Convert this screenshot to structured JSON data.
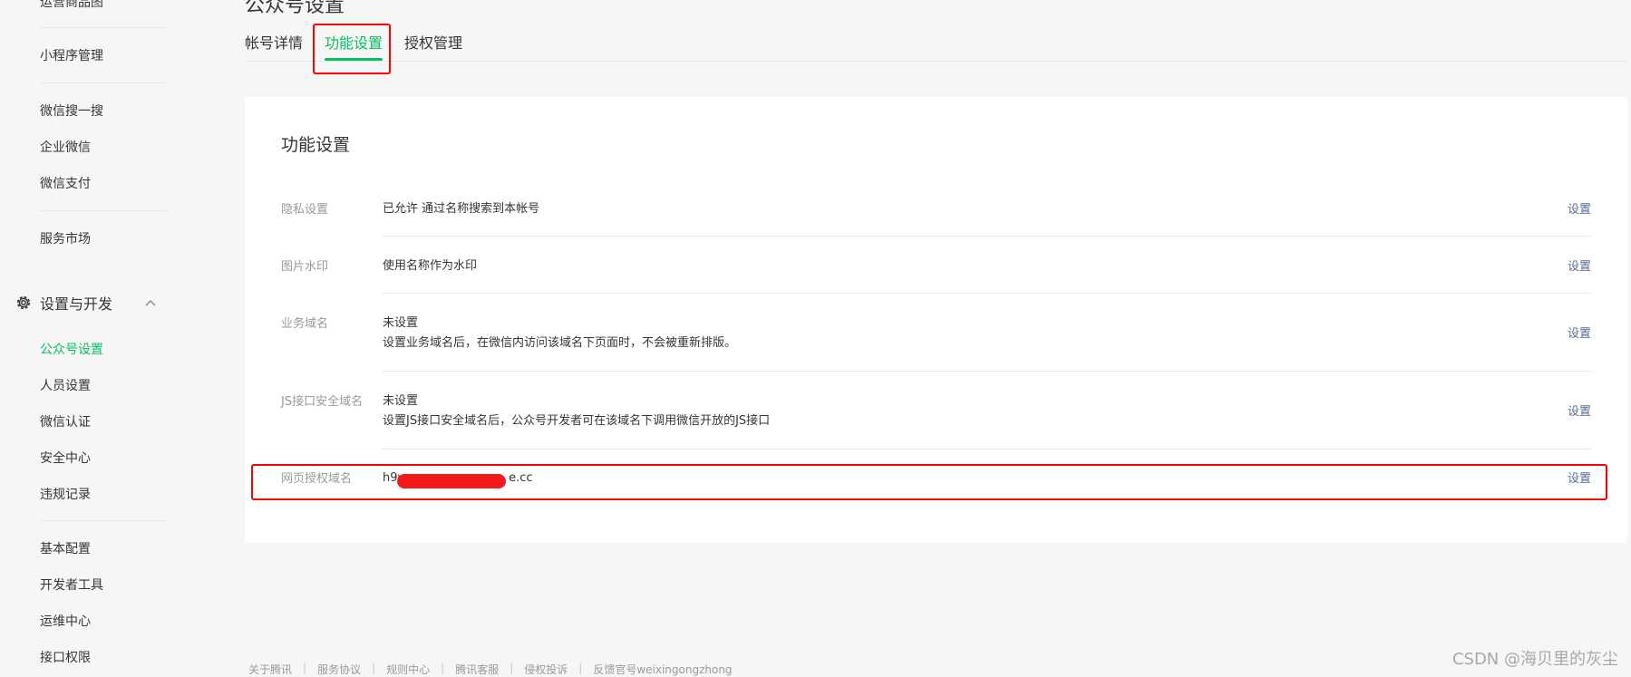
{
  "sidebar": {
    "top_cut": "运营商品图",
    "items": [
      "小程序管理",
      "微信搜一搜",
      "企业微信",
      "微信支付",
      "服务市场"
    ],
    "group": {
      "label": "设置与开发",
      "icon": "gear-icon",
      "chevron": "chevron-up-icon"
    },
    "group_items": [
      "公众号设置",
      "人员设置",
      "微信认证",
      "安全中心",
      "违规记录"
    ],
    "bottom_items": [
      "基本配置",
      "开发者工具",
      "运维中心",
      "接口权限"
    ],
    "active_item": "公众号设置"
  },
  "page": {
    "title": "公众号设置"
  },
  "tabs": [
    "帐号详情",
    "功能设置",
    "授权管理"
  ],
  "active_tab": "功能设置",
  "card": {
    "title": "功能设置",
    "rows": [
      {
        "label": "隐私设置",
        "value": "已允许 通过名称搜索到本帐号",
        "desc": "",
        "action": "设置"
      },
      {
        "label": "图片水印",
        "value": "使用名称作为水印",
        "desc": "",
        "action": "设置"
      },
      {
        "label": "业务域名",
        "value": "未设置",
        "desc": "设置业务域名后，在微信内访问该域名下页面时，不会被重新排版。",
        "action": "设置"
      },
      {
        "label": "JS接口安全域名",
        "value": "未设置",
        "desc": "设置JS接口安全域名后，公众号开发者可在该域名下调用微信开放的JS接口",
        "action": "设置"
      },
      {
        "label": "网页授权域名",
        "value": "h9w",
        "value_tail": "e.cc",
        "desc": "",
        "action": "设置"
      }
    ]
  },
  "footer": [
    "关于腾讯",
    "服务协议",
    "规则中心",
    "腾讯客服",
    "侵权投诉",
    "反馈官号weixingongzhong"
  ],
  "watermark": "CSDN @海贝里的灰尘",
  "colors": {
    "accent": "#07c160",
    "link": "#576b95",
    "highlight": "#ff0000"
  }
}
